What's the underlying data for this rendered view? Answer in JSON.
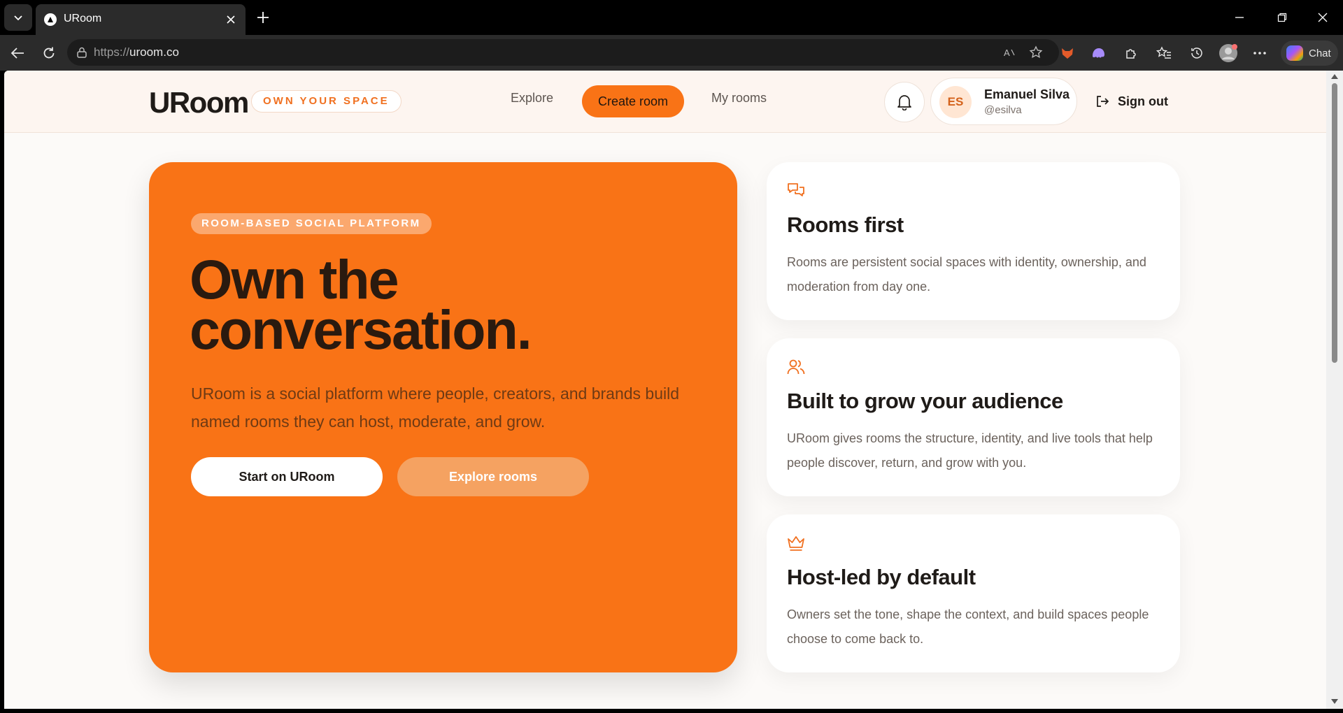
{
  "browser": {
    "tab_title": "URoom",
    "url_scheme": "https://",
    "url_host": "uroom.co",
    "chat_label": "Chat"
  },
  "header": {
    "logo": "URoom",
    "tagline": "OWN YOUR SPACE",
    "nav": {
      "explore": "Explore",
      "create_room": "Create room",
      "my_rooms": "My rooms"
    },
    "user": {
      "initials": "ES",
      "name": "Emanuel Silva",
      "handle": "@esilva"
    },
    "sign_out": "Sign out"
  },
  "hero": {
    "badge": "ROOM-BASED SOCIAL PLATFORM",
    "title": "Own the conversation.",
    "subtitle": "URoom is a social platform where people, creators, and brands build named rooms they can host, moderate, and grow.",
    "primary_button": "Start on URoom",
    "secondary_button": "Explore rooms"
  },
  "features": [
    {
      "icon": "chat-bubbles-icon",
      "title": "Rooms first",
      "description": "Rooms are persistent social spaces with identity, ownership, and moderation from day one."
    },
    {
      "icon": "users-icon",
      "title": "Built to grow your audience",
      "description": "URoom gives rooms the structure, identity, and live tools that help people discover, return, and grow with you."
    },
    {
      "icon": "crown-icon",
      "title": "Host-led by default",
      "description": "Owners set the tone, shape the context, and build spaces people choose to come back to."
    }
  ],
  "colors": {
    "accent": "#f97316",
    "hero_text": "#2a1a0f",
    "page_bg": "#fcfaf8"
  }
}
